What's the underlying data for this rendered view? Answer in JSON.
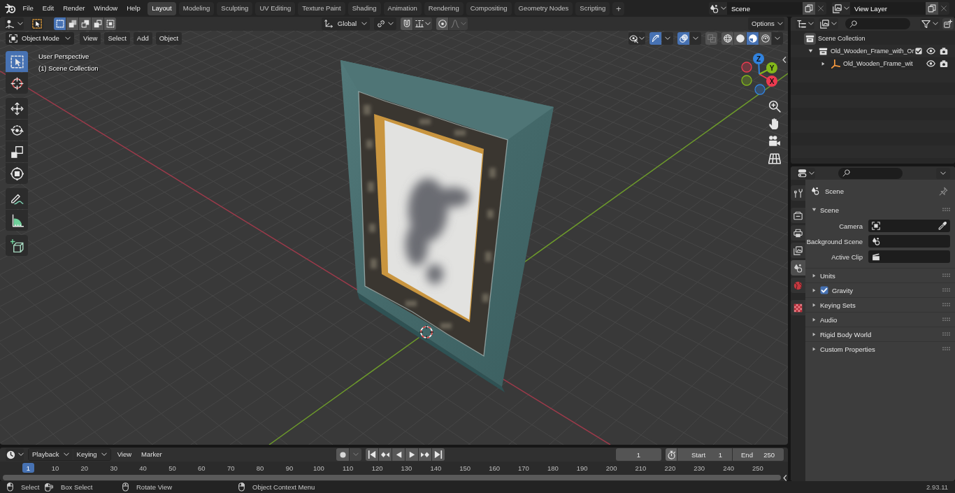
{
  "top_bar": {
    "menus": [
      "File",
      "Edit",
      "Render",
      "Window",
      "Help"
    ],
    "workspaces": [
      {
        "label": "Layout",
        "selected": true
      },
      {
        "label": "Modeling",
        "selected": false
      },
      {
        "label": "Sculpting",
        "selected": false
      },
      {
        "label": "UV Editing",
        "selected": false
      },
      {
        "label": "Texture Paint",
        "selected": false
      },
      {
        "label": "Shading",
        "selected": false
      },
      {
        "label": "Animation",
        "selected": false
      },
      {
        "label": "Rendering",
        "selected": false
      },
      {
        "label": "Compositing",
        "selected": false
      },
      {
        "label": "Geometry Nodes",
        "selected": false
      },
      {
        "label": "Scripting",
        "selected": false
      }
    ],
    "add_workspace": "+",
    "scene": "Scene",
    "view_layer": "View Layer"
  },
  "viewport": {
    "tool_settings": {
      "select_modes": [
        {
          "kind": "set",
          "selected": true
        },
        {
          "kind": "extend",
          "selected": false
        },
        {
          "kind": "subtract",
          "selected": false
        },
        {
          "kind": "invert",
          "selected": false
        },
        {
          "kind": "intersect",
          "selected": false
        }
      ],
      "orientation": "Global",
      "snap": false,
      "proportional_editing": false,
      "options": "Options"
    },
    "header": {
      "mode": "Object Mode",
      "menus": [
        "View",
        "Select",
        "Add",
        "Object"
      ],
      "gizmos": true,
      "overlays": true,
      "xray": false,
      "shading": [
        {
          "kind": "wireframe",
          "selected": false
        },
        {
          "kind": "solid",
          "selected": false
        },
        {
          "kind": "material",
          "selected": true
        },
        {
          "kind": "rendered",
          "selected": false
        }
      ]
    },
    "toolbar": [
      {
        "tools": [
          {
            "kind": "select-box",
            "selected": true
          },
          {
            "kind": "cursor",
            "selected": false
          }
        ]
      },
      {
        "tools": [
          {
            "kind": "move",
            "selected": false
          },
          {
            "kind": "rotate",
            "selected": false
          },
          {
            "kind": "scale",
            "selected": false
          },
          {
            "kind": "transform",
            "selected": false
          }
        ]
      },
      {
        "tools": [
          {
            "kind": "annotate",
            "selected": false
          },
          {
            "kind": "measure",
            "selected": false
          }
        ]
      },
      {
        "tools": [
          {
            "kind": "add-cube",
            "selected": false
          }
        ]
      }
    ],
    "info": [
      "User Perspective",
      "(1) Scene Collection"
    ],
    "axes": [
      {
        "label": "X",
        "color": "#ee3a50"
      },
      {
        "label": "Y",
        "color": "#83b81a"
      },
      {
        "label": "Z",
        "color": "#3182de"
      }
    ],
    "navigation": [
      {
        "kind": "zoom"
      },
      {
        "kind": "pan"
      },
      {
        "kind": "camera"
      },
      {
        "kind": "perspective"
      }
    ]
  },
  "outliner": {
    "tree": [
      {
        "label": "Scene Collection",
        "kind": "scene-collection",
        "children": [
          {
            "label": "Old_Wooden_Frame_with_Or",
            "kind": "collection",
            "expanded": true,
            "checked": true,
            "children": [
              {
                "label": "Old_Wooden_Frame_wit",
                "kind": "empty",
                "expanded": false
              }
            ]
          }
        ]
      }
    ]
  },
  "properties": {
    "tab_groups": [
      {
        "tabs": [
          {
            "kind": "tool",
            "selected": false
          }
        ]
      },
      {
        "tabs": [
          {
            "kind": "render",
            "selected": false
          },
          {
            "kind": "output",
            "selected": false
          },
          {
            "kind": "view-layer",
            "selected": false
          },
          {
            "kind": "scene",
            "selected": true
          },
          {
            "kind": "world",
            "selected": false
          }
        ]
      },
      {
        "tabs": [
          {
            "kind": "texture",
            "selected": false
          }
        ]
      }
    ],
    "context": "Scene",
    "panels": [
      {
        "title": "Scene",
        "expanded": true,
        "fields": [
          {
            "label": "Camera",
            "kind": "object"
          },
          {
            "label": "Background Scene",
            "kind": "scene"
          },
          {
            "label": "Active Clip",
            "kind": "clip"
          }
        ]
      },
      {
        "title": "Units",
        "expanded": false
      },
      {
        "title": "Gravity",
        "expanded": false,
        "checked": true
      },
      {
        "title": "Keying Sets",
        "expanded": false
      },
      {
        "title": "Audio",
        "expanded": false
      },
      {
        "title": "Rigid Body World",
        "expanded": false
      },
      {
        "title": "Custom Properties",
        "expanded": false
      }
    ]
  },
  "timeline": {
    "menus": [
      {
        "label": "Playback",
        "kind": "dropdown"
      },
      {
        "label": "Keying",
        "kind": "dropdown"
      },
      {
        "label": "View",
        "kind": "menu"
      },
      {
        "label": "Marker",
        "kind": "menu"
      }
    ],
    "auto_keying": false,
    "controls": [
      {
        "kind": "jump-start"
      },
      {
        "kind": "prev-key"
      },
      {
        "kind": "play-reverse"
      },
      {
        "kind": "play"
      },
      {
        "kind": "next-key"
      },
      {
        "kind": "jump-end"
      }
    ],
    "current_frame": "1",
    "start": {
      "label": "Start",
      "value": "1"
    },
    "end": {
      "label": "End",
      "value": "250"
    },
    "ruler": {
      "current": "1",
      "ticks": [
        "10",
        "20",
        "30",
        "40",
        "50",
        "60",
        "70",
        "80",
        "90",
        "100",
        "110",
        "120",
        "130",
        "140",
        "150",
        "160",
        "170",
        "180",
        "190",
        "200",
        "210",
        "220",
        "230",
        "240",
        "250"
      ]
    }
  },
  "status_bar": {
    "hints": [
      {
        "kind": "left-click",
        "label": "Select"
      },
      {
        "kind": "left-drag",
        "label": "Box Select"
      },
      {
        "kind": "middle-click",
        "label": "Rotate View"
      },
      {
        "kind": "right-click",
        "label": "Object Context Menu"
      }
    ],
    "version": "2.93.11"
  }
}
